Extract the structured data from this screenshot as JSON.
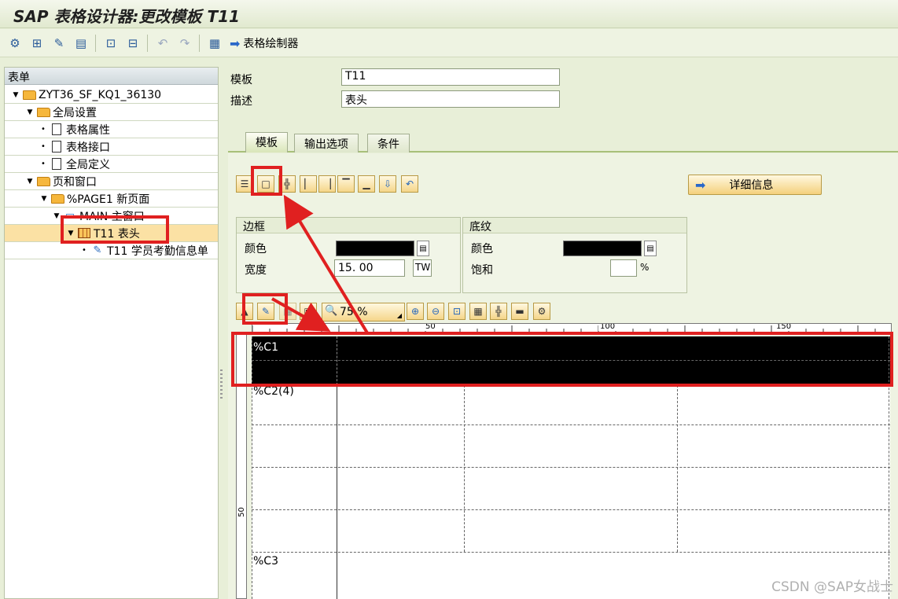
{
  "title": "SAP 表格设计器:更改模板 T11",
  "toolbar": {
    "label": "表格绘制器"
  },
  "tree": {
    "header": "表单",
    "nodes": [
      {
        "label": "ZYT36_SF_KQ1_36130"
      },
      {
        "label": "全局设置"
      },
      {
        "label": "表格属性"
      },
      {
        "label": "表格接口"
      },
      {
        "label": "全局定义"
      },
      {
        "label": "页和窗口"
      },
      {
        "label": "%PAGE1 新页面"
      },
      {
        "label": "MAIN 主窗口"
      },
      {
        "label": "T11 表头"
      },
      {
        "label": "T11 学员考勤信息单"
      }
    ]
  },
  "form": {
    "template_label": "模板",
    "template_value": "T11",
    "desc_label": "描述",
    "desc_value": "表头"
  },
  "tabs": [
    "模板",
    "输出选项",
    "条件"
  ],
  "detail_button": "详细信息",
  "border_group": {
    "title": "边框",
    "color_label": "颜色",
    "width_label": "宽度",
    "width_value": "15. 00",
    "unit": "TW"
  },
  "shade_group": {
    "title": "底纹",
    "color_label": "颜色",
    "saturation_label": "饱和",
    "percent": "%"
  },
  "zoom": "75 %",
  "ruler": {
    "h_marks": [
      "50",
      "100",
      "150"
    ],
    "v_mark": "50"
  },
  "canvas": {
    "row1": "%C1",
    "row2": "%C2(4)",
    "row3": "%C3"
  },
  "watermark": "CSDN @SAP女战士"
}
